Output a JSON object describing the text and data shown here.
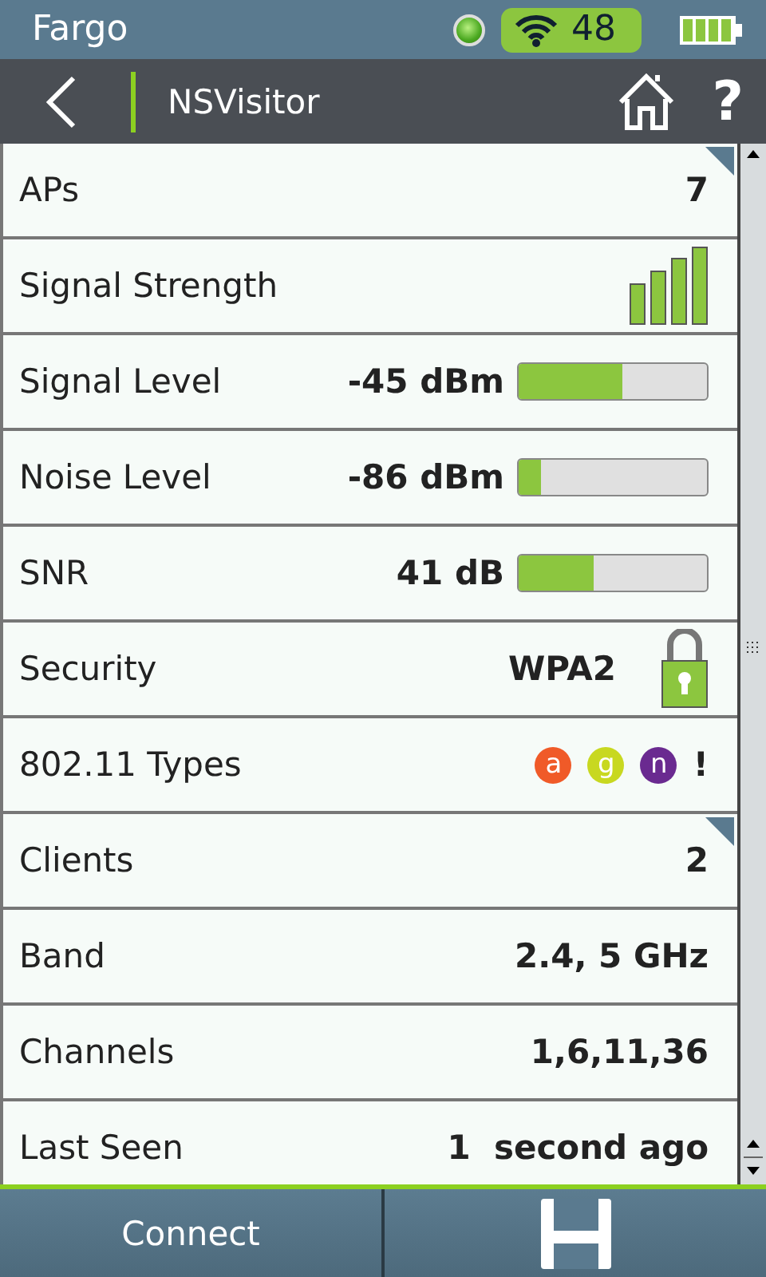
{
  "status_bar": {
    "device": "Fargo",
    "wifi_count": "48"
  },
  "header": {
    "title": "NSVisitor",
    "help": "?"
  },
  "rows": [
    {
      "kind": "value",
      "label": "APs",
      "value": "7",
      "has_details": true
    },
    {
      "kind": "bars",
      "label": "Signal Strength",
      "has_details": false
    },
    {
      "kind": "meter",
      "label": "Signal Level",
      "value": "-45 dBm",
      "level": 0.55,
      "has_details": false
    },
    {
      "kind": "meter",
      "label": "Noise Level",
      "value": "-86 dBm",
      "level": 0.12,
      "has_details": false
    },
    {
      "kind": "meter",
      "label": "SNR",
      "value": "41 dB",
      "level": 0.4,
      "has_details": false
    },
    {
      "kind": "lock",
      "label": "Security",
      "value": "WPA2",
      "has_details": false
    },
    {
      "kind": "types",
      "label": "802.11 Types",
      "types": [
        {
          "text": "a",
          "color": "#f05a28"
        },
        {
          "text": "g",
          "color": "#c8d820"
        },
        {
          "text": "n",
          "color": "#6a2a90"
        }
      ],
      "note": "!",
      "has_details": false
    },
    {
      "kind": "value",
      "label": "Clients",
      "value": "2",
      "has_details": true
    },
    {
      "kind": "value",
      "label": "Band",
      "value": "2.4, 5 GHz",
      "has_details": false
    },
    {
      "kind": "value",
      "label": "Channels",
      "value": "1,6,11,36",
      "has_details": false
    },
    {
      "kind": "value",
      "label": "Last Seen",
      "value": "1  second ago",
      "has_details": false
    }
  ],
  "buttons": [
    {
      "kind": "text",
      "label": "Connect"
    },
    {
      "kind": "save"
    }
  ]
}
